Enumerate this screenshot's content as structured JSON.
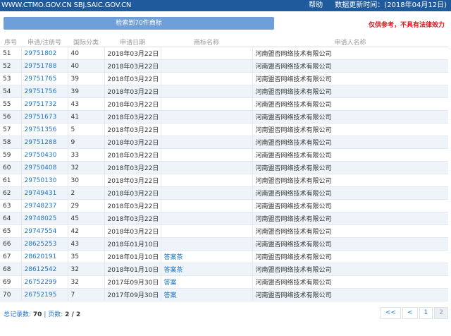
{
  "header": {
    "domains": "WWW.CTMO.GOV.CN SBJ.SAIC.GOV.CN",
    "help": "帮助",
    "update_text": "数据更新时间：(2018年04月12日)"
  },
  "result_button": "检索到70件商标",
  "disclaimer": "仅供参考，不具有法律效力",
  "table": {
    "columns": [
      "序号",
      "申请/注册号",
      "国际分类",
      "申请日期",
      "商标名称",
      "申请人名称"
    ],
    "rows": [
      {
        "no": "51",
        "reg": "29751802",
        "cls": "40",
        "date": "2018年03月22日",
        "mark": "",
        "applicant": "河南盟否网络技术有限公司"
      },
      {
        "no": "52",
        "reg": "29751788",
        "cls": "40",
        "date": "2018年03月22日",
        "mark": "",
        "applicant": "河南盟否网络技术有限公司"
      },
      {
        "no": "53",
        "reg": "29751765",
        "cls": "39",
        "date": "2018年03月22日",
        "mark": "",
        "applicant": "河南盟否网络技术有限公司"
      },
      {
        "no": "54",
        "reg": "29751756",
        "cls": "39",
        "date": "2018年03月22日",
        "mark": "",
        "applicant": "河南盟否网络技术有限公司"
      },
      {
        "no": "55",
        "reg": "29751732",
        "cls": "43",
        "date": "2018年03月22日",
        "mark": "",
        "applicant": "河南盟否网络技术有限公司"
      },
      {
        "no": "56",
        "reg": "29751673",
        "cls": "41",
        "date": "2018年03月22日",
        "mark": "",
        "applicant": "河南盟否网络技术有限公司"
      },
      {
        "no": "57",
        "reg": "29751356",
        "cls": "5",
        "date": "2018年03月22日",
        "mark": "",
        "applicant": "河南盟否网络技术有限公司"
      },
      {
        "no": "58",
        "reg": "29751288",
        "cls": "9",
        "date": "2018年03月22日",
        "mark": "",
        "applicant": "河南盟否网络技术有限公司"
      },
      {
        "no": "59",
        "reg": "29750430",
        "cls": "33",
        "date": "2018年03月22日",
        "mark": "",
        "applicant": "河南盟否网络技术有限公司"
      },
      {
        "no": "60",
        "reg": "29750408",
        "cls": "32",
        "date": "2018年03月22日",
        "mark": "",
        "applicant": "河南盟否网络技术有限公司"
      },
      {
        "no": "61",
        "reg": "29750130",
        "cls": "30",
        "date": "2018年03月22日",
        "mark": "",
        "applicant": "河南盟否网络技术有限公司"
      },
      {
        "no": "62",
        "reg": "29749431",
        "cls": "2",
        "date": "2018年03月22日",
        "mark": "",
        "applicant": "河南盟否网络技术有限公司"
      },
      {
        "no": "63",
        "reg": "29748237",
        "cls": "29",
        "date": "2018年03月22日",
        "mark": "",
        "applicant": "河南盟否网络技术有限公司"
      },
      {
        "no": "64",
        "reg": "29748025",
        "cls": "45",
        "date": "2018年03月22日",
        "mark": "",
        "applicant": "河南盟否网络技术有限公司"
      },
      {
        "no": "65",
        "reg": "29747554",
        "cls": "42",
        "date": "2018年03月22日",
        "mark": "",
        "applicant": "河南盟否网络技术有限公司"
      },
      {
        "no": "66",
        "reg": "28625253",
        "cls": "43",
        "date": "2018年01月10日",
        "mark": "",
        "applicant": "河南盟否网络技术有限公司"
      },
      {
        "no": "67",
        "reg": "28620191",
        "cls": "35",
        "date": "2018年01月10日",
        "mark": "答案茶",
        "applicant": "河南盟否网络技术有限公司"
      },
      {
        "no": "68",
        "reg": "28612542",
        "cls": "32",
        "date": "2018年01月10日",
        "mark": "答案茶",
        "applicant": "河南盟否网络技术有限公司"
      },
      {
        "no": "69",
        "reg": "26752299",
        "cls": "32",
        "date": "2017年09月30日",
        "mark": "答案",
        "applicant": "河南盟否网络技术有限公司"
      },
      {
        "no": "70",
        "reg": "26752195",
        "cls": "7",
        "date": "2017年09月30日",
        "mark": "答案",
        "applicant": "河南盟否网络技术有限公司"
      }
    ]
  },
  "summary": {
    "records_label": "总记录数:",
    "records_value": "70",
    "sep": "|",
    "pages_label": "页数:",
    "pages_value": "2 / 2"
  },
  "pager": {
    "first": "<<",
    "prev": "<",
    "page1": "1",
    "page2": "2",
    "current": "2"
  },
  "colors": {
    "topbar": "#1f5a9c",
    "button": "#6f9fd8",
    "link": "#1f74c2",
    "disclaimer": "#e0141d",
    "row_alt": "#eef4fa"
  }
}
